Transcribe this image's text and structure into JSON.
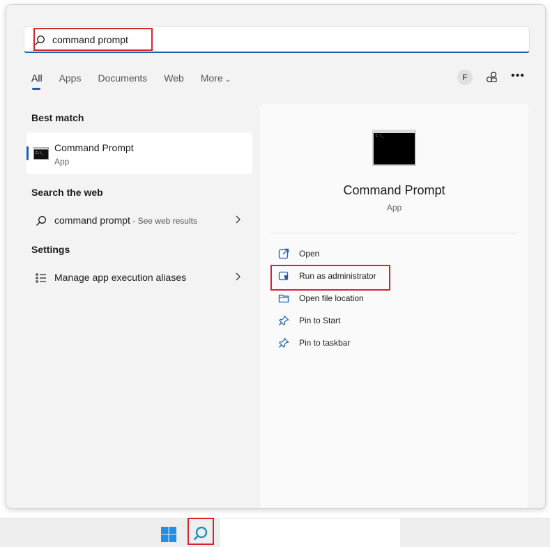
{
  "search": {
    "query": "command prompt"
  },
  "tabs": [
    {
      "label": "All",
      "active": true
    },
    {
      "label": "Apps"
    },
    {
      "label": "Documents"
    },
    {
      "label": "Web"
    },
    {
      "label": "More"
    }
  ],
  "toolbar": {
    "avatar_letter": "F",
    "more_label": "•••"
  },
  "best_match": {
    "heading": "Best match",
    "title": "Command Prompt",
    "subtitle": "App"
  },
  "web": {
    "heading": "Search the web",
    "query": "command prompt",
    "suffix": " - See web results"
  },
  "settings": {
    "heading": "Settings",
    "item": "Manage app execution aliases"
  },
  "preview": {
    "title": "Command Prompt",
    "subtitle": "App",
    "prompt_glyph": "C:\\_",
    "actions": [
      {
        "label": "Open",
        "icon": "open-icon"
      },
      {
        "label": "Run as administrator",
        "icon": "shield-icon"
      },
      {
        "label": "Open file location",
        "icon": "folder-icon"
      },
      {
        "label": "Pin to Start",
        "icon": "pin-icon"
      },
      {
        "label": "Pin to taskbar",
        "icon": "pin-icon"
      }
    ]
  },
  "colors": {
    "accent": "#1a5fb4",
    "highlight": "#d9222a"
  }
}
